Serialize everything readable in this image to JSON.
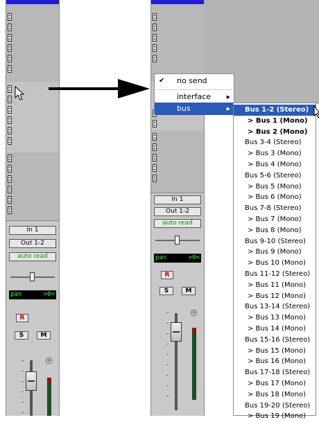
{
  "left_strip": {
    "input_label": "In 1",
    "output_label": "Out 1-2",
    "automation_label": "auto read",
    "pan_label": "pan",
    "pan_value": ">0<",
    "record_label": "R",
    "solo_label": "S",
    "mute_label": "M"
  },
  "right_strip": {
    "input_label": "In 1",
    "output_label": "Out 1-2",
    "automation_label": "auto read",
    "pan_label": "pan",
    "pan_value": ">0<",
    "record_label": "R",
    "solo_label": "S",
    "mute_label": "M"
  },
  "send_menu": {
    "items": [
      {
        "label": "no send",
        "checked": true
      },
      {
        "label": "interface",
        "has_submenu": true
      },
      {
        "label": "bus",
        "has_submenu": true,
        "selected": true
      }
    ],
    "check_glyph": "✔",
    "submenu_arrow": "▶"
  },
  "bus_menu": {
    "items": [
      {
        "label": "Bus 1-2 (Stereo)",
        "style": "selected"
      },
      {
        "label": "> Bus 1 (Mono)",
        "style": "bold"
      },
      {
        "label": "> Bus 2 (Mono)",
        "style": "bold"
      },
      {
        "label": "Bus 3-4 (Stereo)",
        "style": "normal"
      },
      {
        "label": "> Bus 3 (Mono)",
        "style": "normal"
      },
      {
        "label": "> Bus 4 (Mono)",
        "style": "normal"
      },
      {
        "label": "Bus 5-6 (Stereo)",
        "style": "normal"
      },
      {
        "label": "> Bus 5 (Mono)",
        "style": "normal"
      },
      {
        "label": "> Bus 6 (Mono)",
        "style": "normal"
      },
      {
        "label": "Bus 7-8 (Stereo)",
        "style": "normal"
      },
      {
        "label": "> Bus 7 (Mono)",
        "style": "normal"
      },
      {
        "label": "> Bus 8 (Mono)",
        "style": "normal"
      },
      {
        "label": "Bus 9-10 (Stereo)",
        "style": "normal"
      },
      {
        "label": "> Bus 9 (Mono)",
        "style": "normal"
      },
      {
        "label": "> Bus 10 (Mono)",
        "style": "normal"
      },
      {
        "label": "Bus 11-12 (Stereo)",
        "style": "normal"
      },
      {
        "label": "> Bus 11 (Mono)",
        "style": "normal"
      },
      {
        "label": "> Bus 12 (Mono)",
        "style": "normal"
      },
      {
        "label": "Bus 13-14 (Stereo)",
        "style": "normal"
      },
      {
        "label": "> Bus 13 (Mono)",
        "style": "normal"
      },
      {
        "label": "> Bus 14 (Mono)",
        "style": "normal"
      },
      {
        "label": "Bus 15-16 (Stereo)",
        "style": "normal"
      },
      {
        "label": "> Bus 15 (Mono)",
        "style": "normal"
      },
      {
        "label": "> Bus 16 (Mono)",
        "style": "normal"
      },
      {
        "label": "Bus 17-18 (Stereo)",
        "style": "normal"
      },
      {
        "label": "> Bus 17 (Mono)",
        "style": "normal"
      },
      {
        "label": "> Bus 18 (Mono)",
        "style": "normal"
      },
      {
        "label": "Bus 19-20 (Stereo)",
        "style": "normal"
      },
      {
        "label": "> Bus 19 (Mono)",
        "style": "normal"
      }
    ]
  },
  "colors": {
    "menu_highlight": "#2a5bb8",
    "strip_background": "#c9c9c9",
    "insert_section": "#b8b8b8",
    "top_bar": "#1f1fd0",
    "automation_text": "#0a8a0a",
    "pan_display_text": "#33ff33",
    "record_text": "#cc0000",
    "meter_green": "#0a5a1f"
  },
  "icons": {
    "arrow": "right-arrow-icon",
    "cursor": "mouse-pointer-icon",
    "group": "group-id-icon"
  }
}
